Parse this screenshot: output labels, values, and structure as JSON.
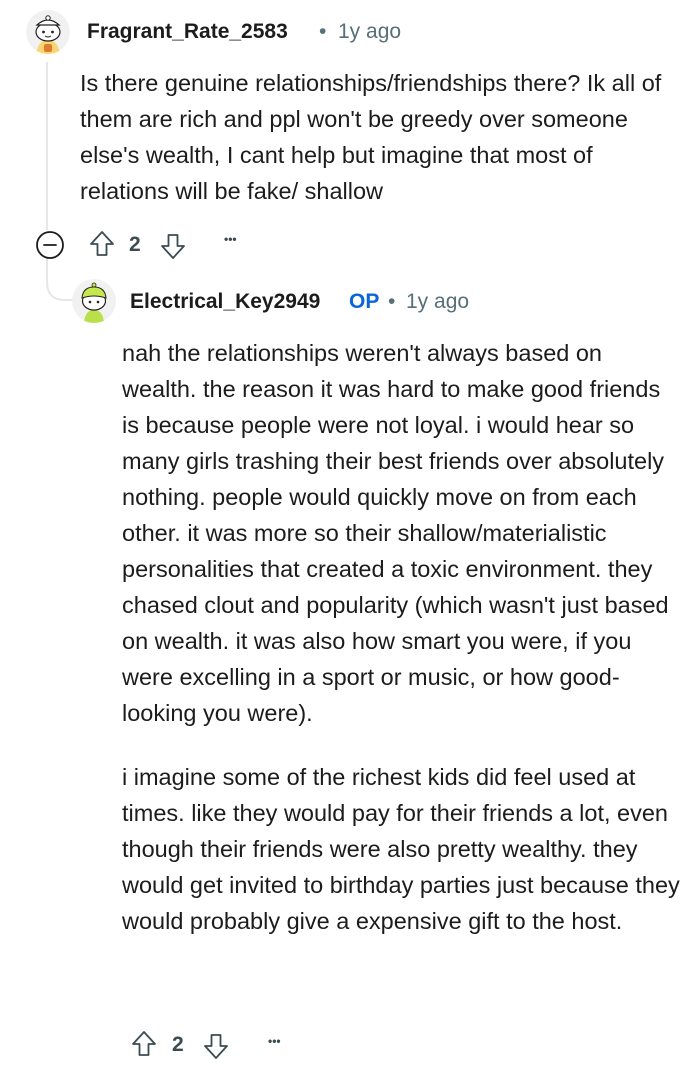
{
  "comments": [
    {
      "username": "Fragrant_Rate_2583",
      "separator": "•",
      "time": "1y ago",
      "body": "Is there genuine relationships/friendships there? Ik all of them are rich and ppl won't be greedy over someone else's wealth, I cant help but imagine that most of relations will be fake/ shallow",
      "votes": "2",
      "icons": {
        "collapse": "collapse-minus-icon",
        "upvote": "upvote-arrow-icon",
        "downvote": "downvote-arrow-icon",
        "more": "more-options-icon"
      }
    },
    {
      "username": "Electrical_Key2949",
      "badge": "OP",
      "separator": "•",
      "time": "1y ago",
      "paragraphs": [
        "nah the relationships weren't always based on wealth. the reason it was hard to make good friends is because people were not loyal. i would hear so many girls trashing their best friends over absolutely nothing. people would quickly move on from each other. it was more so their shallow/materialistic personalities that created a toxic environment. they chased clout and popularity (which wasn't just based on wealth. it was also how smart you were, if you were excelling in a sport or music, or how good-looking you were).",
        "i imagine some of the richest kids did feel used at times. like they would pay for their friends a lot, even though their friends were also pretty wealthy. they would get invited to birthday parties just because they would probably give a expensive gift to the host."
      ],
      "votes": "2",
      "more": "•••"
    }
  ],
  "more_label": "•••",
  "colors": {
    "op_badge": "#0a66d8",
    "meta": "#576f76",
    "thread_line": "#e5e7e9"
  }
}
